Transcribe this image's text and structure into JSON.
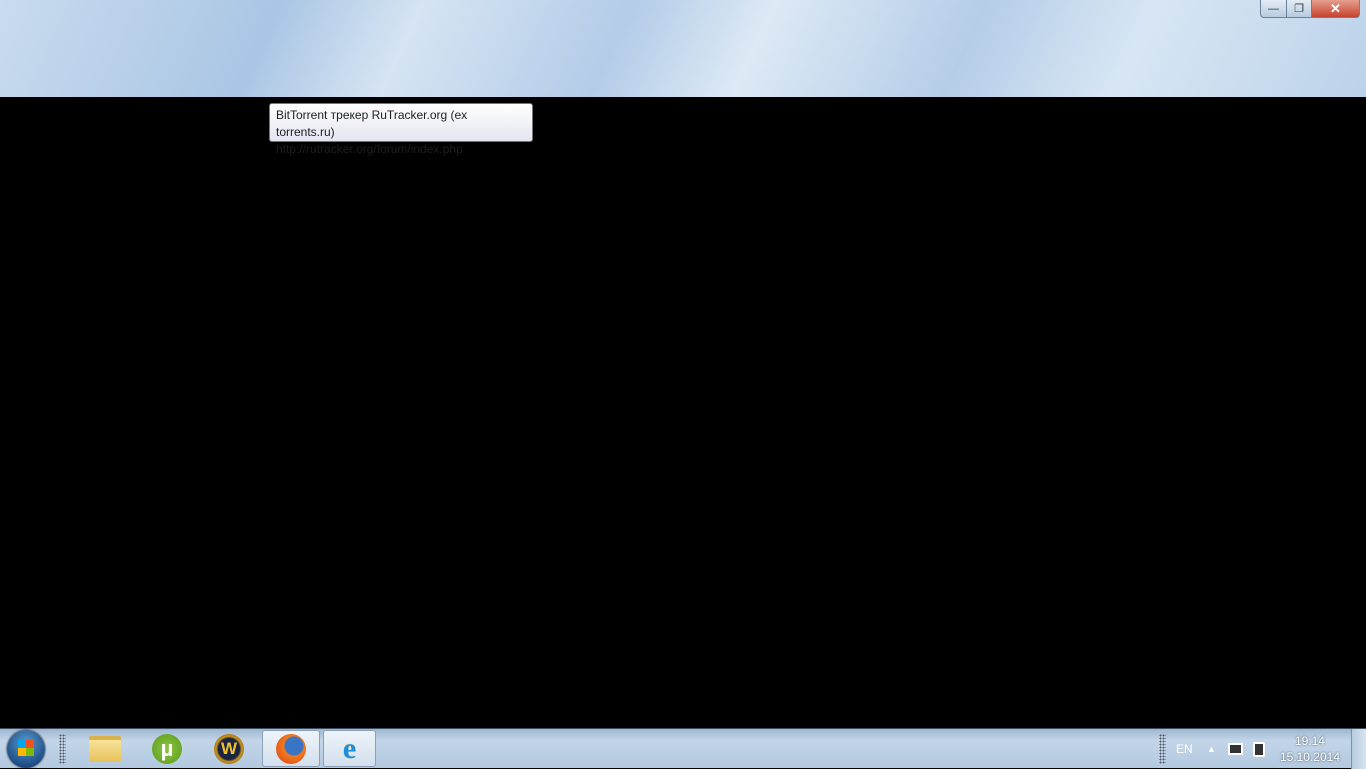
{
  "window": {
    "minimize": "—",
    "maximize": "❐",
    "close": "✕"
  },
  "tooltip": {
    "title": "BitTorrent трекер RuTracker.org (ex torrents.ru)",
    "url": "http://rutracker.org/forum/index.php"
  },
  "taskbar": {
    "items": [
      {
        "name": "Windows Explorer",
        "icon": "folder-icon"
      },
      {
        "name": "uTorrent",
        "icon": "utorrent-icon",
        "glyph": "µ"
      },
      {
        "name": "World of Warcraft",
        "icon": "wow-icon",
        "glyph": "W"
      },
      {
        "name": "Firefox",
        "icon": "firefox-icon"
      },
      {
        "name": "Internet Explorer",
        "icon": "ie-icon",
        "glyph": "e"
      }
    ],
    "language": "EN",
    "tray_expand": "▲",
    "time": "19:14",
    "date": "15.10.2014"
  }
}
